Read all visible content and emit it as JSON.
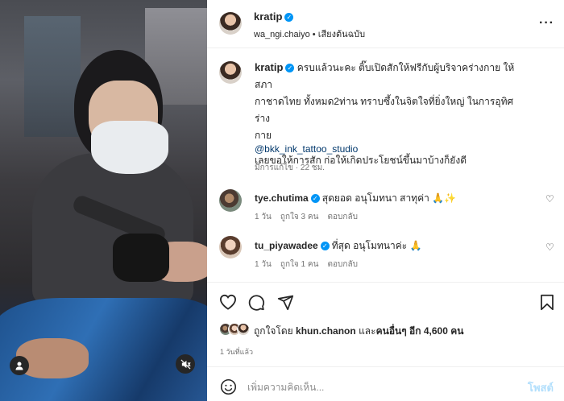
{
  "post": {
    "author": "kratip",
    "subtitle_account": "wa_ngi.chaiyo",
    "subtitle_separator": "•",
    "subtitle_audio": "เสียงต้นฉบับ",
    "caption_line1": "ครบแล้วนะคะ ติ๊บเปิดสักให้ฟรีกับผู้บริจาคร่างกาย ให้สภา",
    "caption_line2": "กาชาดไทย ทั้งหมด2ท่าน ทราบซึ้งในจิตใจที่ยิ่งใหญ่ ในการอุทิศร่าง",
    "caption_line3": "กาย",
    "caption_line4": "เลยขอให้การสัก ก่อให้เกิดประโยชน์ขึ้นมาบ้างก็ยังดี",
    "tag": "@bkk_ink_tattoo_studio",
    "edited_meta": "มีการแก้ไข · 22 ชม."
  },
  "comments": [
    {
      "user": "tye.chutima",
      "text": "สุดยอด อนุโมทนา สาทุค่า 🙏✨",
      "age": "1 วัน",
      "likes": "ถูกใจ 3 คน",
      "reply": "ตอบกลับ"
    },
    {
      "user": "tu_piyawadee",
      "text": "ที่สุด อนุโมทนาค่ะ 🙏",
      "age": "1 วัน",
      "likes": "ถูกใจ 1 คน",
      "reply": "ตอบกลับ"
    }
  ],
  "engagement": {
    "liked_by_prefix": "ถูกใจโดย",
    "liked_by_user": "khun.chanon",
    "liked_by_and": "และ",
    "liked_by_others": "คนอื่นๆ อีก 4,600 คน",
    "time_ago": "1 วันที่แล้ว"
  },
  "composer": {
    "placeholder": "เพิ่มความคิดเห็น...",
    "post_label": "โพสต์"
  },
  "icons": [
    "heart-icon",
    "comment-icon",
    "share-icon",
    "bookmark-icon",
    "emoji-icon",
    "more-icon",
    "user-icon",
    "mute-icon"
  ],
  "colors": {
    "link": "#00376b",
    "verified": "#0095f6",
    "muted": "#737373",
    "post_disabled": "#b2dffc"
  }
}
